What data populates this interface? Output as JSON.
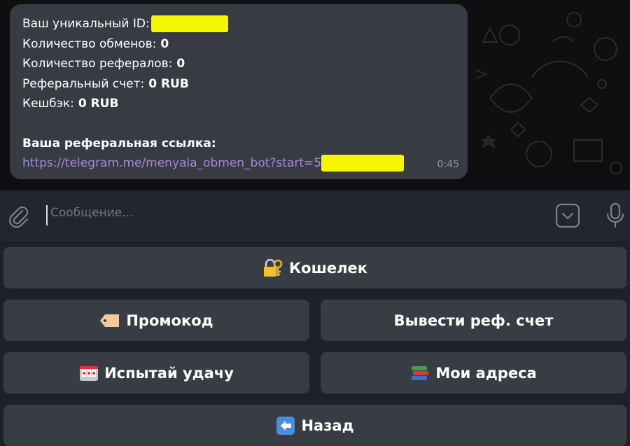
{
  "message": {
    "lines": [
      {
        "label": "Ваш уникальный ID:",
        "value": ""
      },
      {
        "label": "Количество обменов:",
        "value": " 0"
      },
      {
        "label": "Количество рефералов:",
        "value": " 0"
      },
      {
        "label": "Реферальный счет:",
        "value": " 0 RUB"
      },
      {
        "label": "Кешбэк:",
        "value": " 0 RUB"
      }
    ],
    "ref_title": "Ваша реферальная ссылка:",
    "ref_link": "https://telegram.me/menyala_obmen_bot?start=5",
    "time": "0:45",
    "redaction_color": "#f6f600"
  },
  "input": {
    "placeholder": "Сообщение..."
  },
  "keyboard": {
    "wallet": "Кошелек",
    "promo": "Промокод",
    "withdraw": "Вывести реф. счет",
    "luck": "Испытай удачу",
    "addresses": "Мои адреса",
    "back": "Назад"
  },
  "colors": {
    "bubble": "#383b42",
    "link": "#a48ad8",
    "button": "#383c43",
    "background": "#1e2228"
  }
}
